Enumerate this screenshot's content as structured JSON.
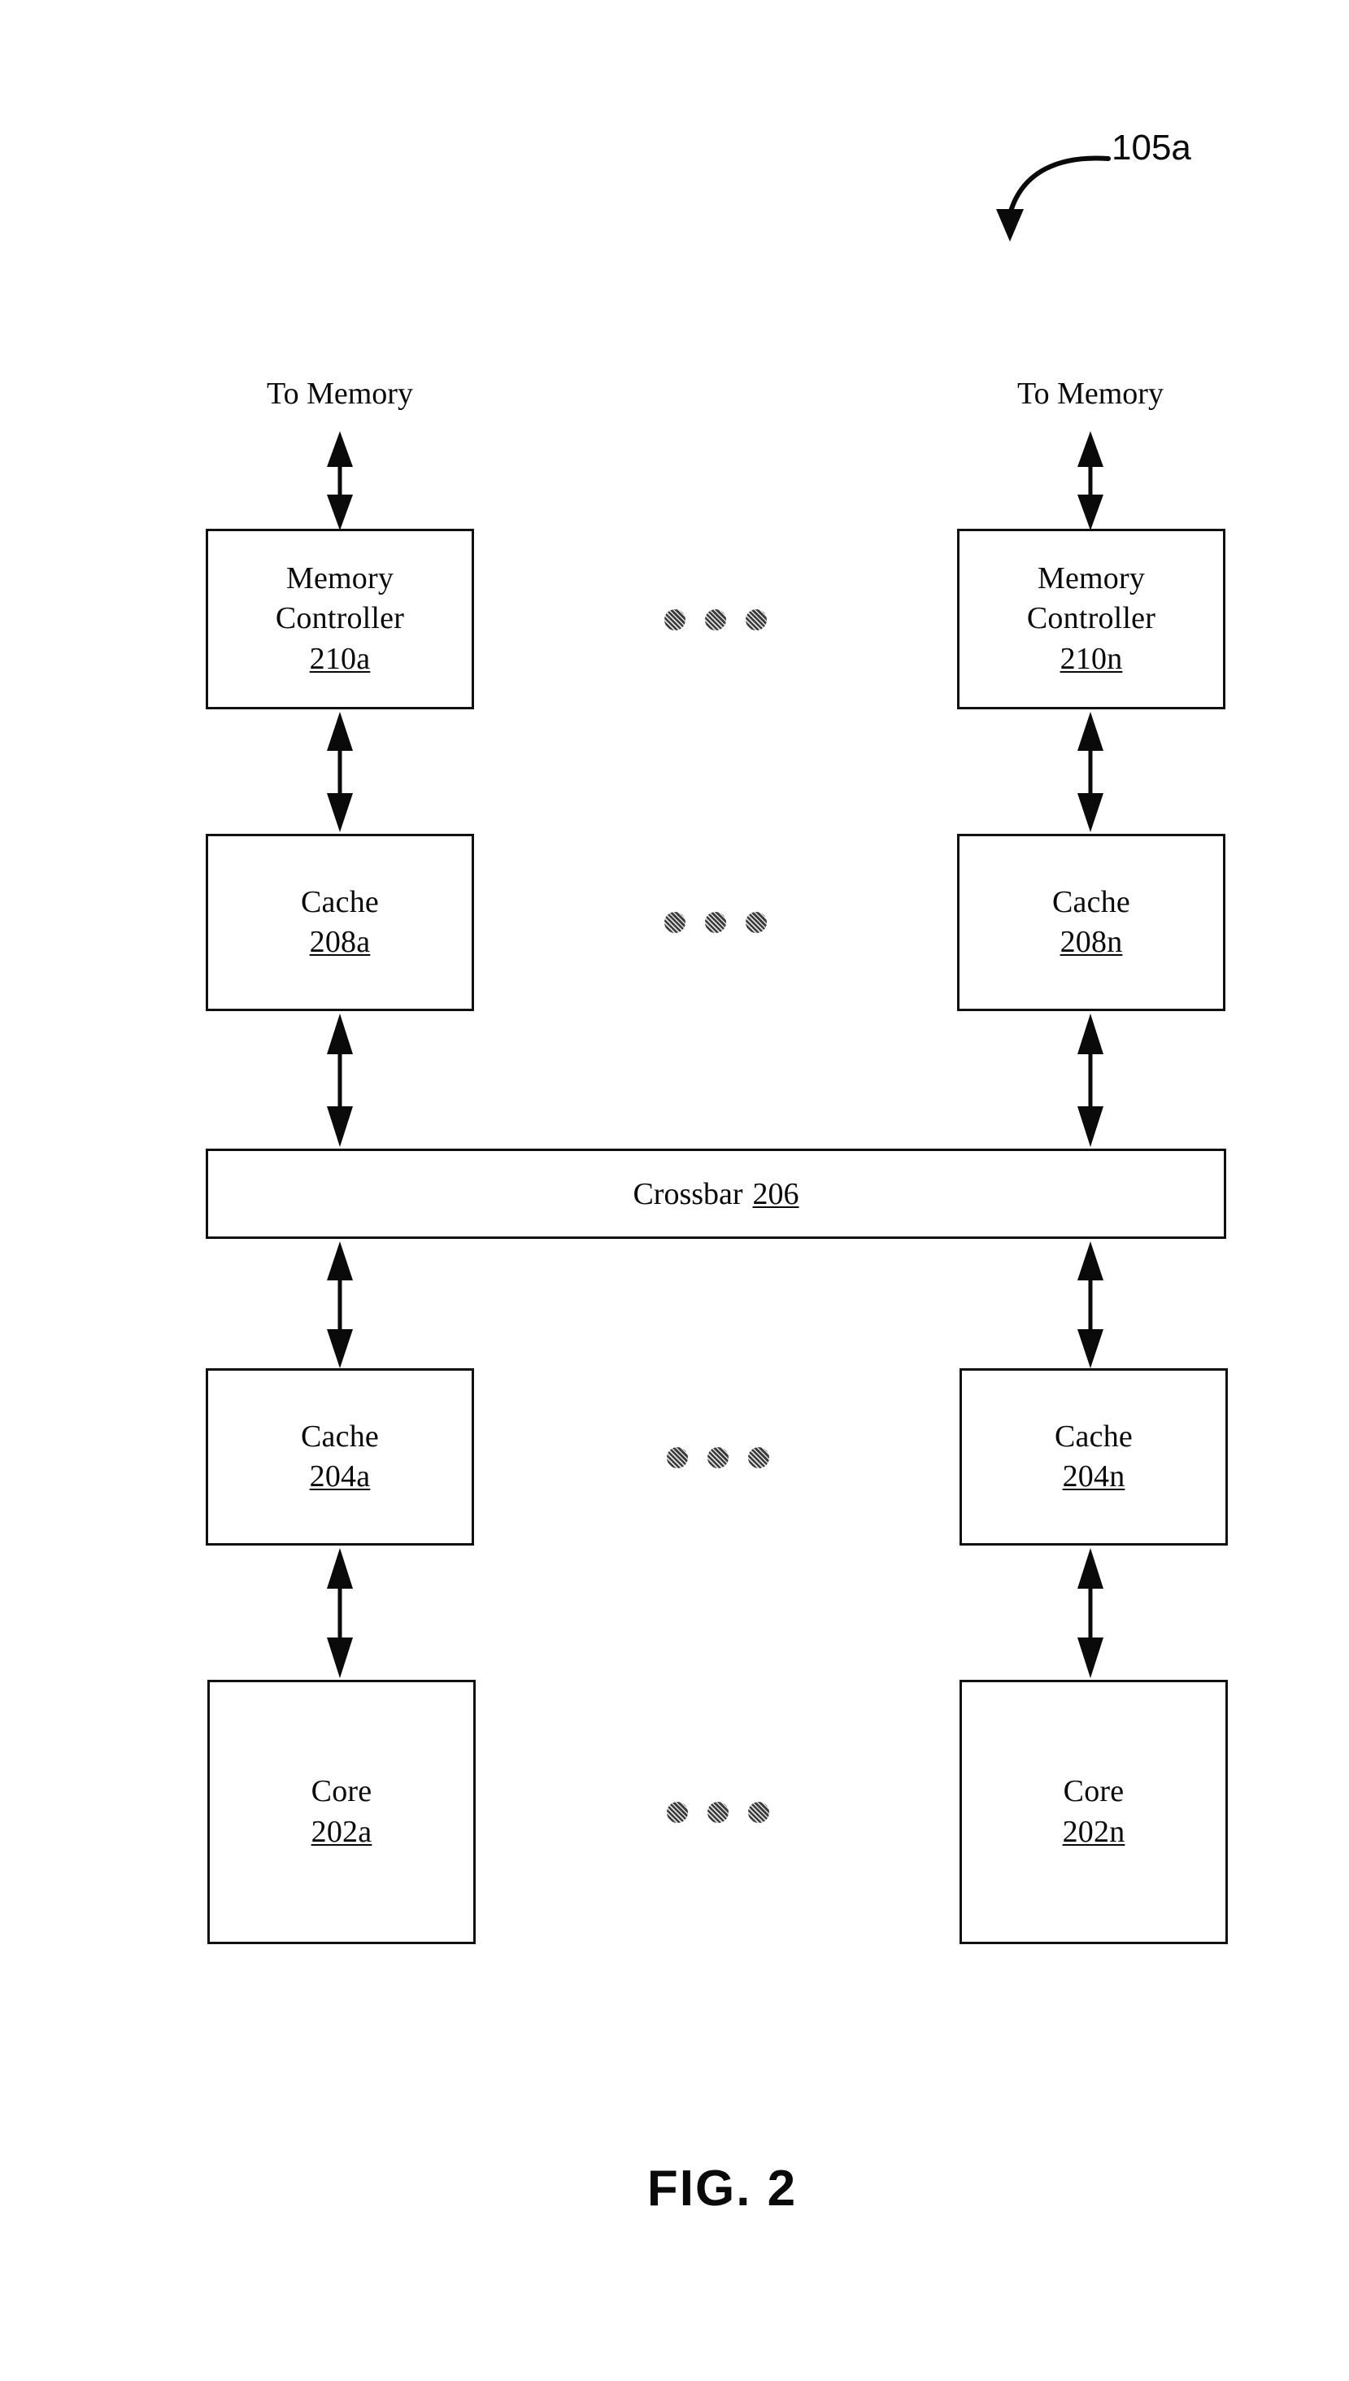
{
  "figure": {
    "caption": "FIG. 2",
    "callout_label": "105a"
  },
  "labels": {
    "to_memory_left": "To Memory",
    "to_memory_right": "To Memory"
  },
  "blocks": {
    "memory_controller_a": {
      "title": "Memory",
      "title2": "Controller",
      "ref": "210a"
    },
    "memory_controller_n": {
      "title": "Memory",
      "title2": "Controller",
      "ref": "210n"
    },
    "cache_208a": {
      "title": "Cache",
      "ref": "208a"
    },
    "cache_208n": {
      "title": "Cache",
      "ref": "208n"
    },
    "crossbar": {
      "title": "Crossbar",
      "ref": "206"
    },
    "cache_204a": {
      "title": "Cache",
      "ref": "204a"
    },
    "cache_204n": {
      "title": "Cache",
      "ref": "204n"
    },
    "core_202a": {
      "title": "Core",
      "ref": "202a"
    },
    "core_202n": {
      "title": "Core",
      "ref": "202n"
    }
  },
  "ellipsis": {
    "row_memory_controller": [
      "dot",
      "dot",
      "dot"
    ],
    "row_cache_208": [
      "dot",
      "dot",
      "dot"
    ],
    "row_cache_204": [
      "dot",
      "dot",
      "dot"
    ],
    "row_core_202": [
      "dot",
      "dot",
      "dot"
    ]
  },
  "colors": {
    "ink": "#0a0a0a",
    "line": "#111111",
    "dot": "#3b3b3b",
    "background": "#ffffff"
  }
}
